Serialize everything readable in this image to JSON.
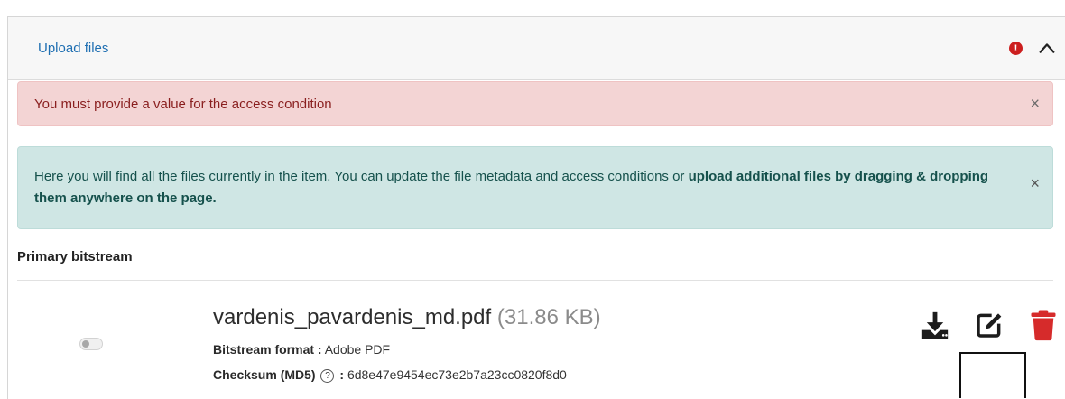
{
  "panel": {
    "title": "Upload files",
    "error_badge": "!"
  },
  "alerts": {
    "danger_text": "You must provide a value for the access condition",
    "info_text_1": "Here you will find all the files currently in the item. You can update the file metadata and access conditions or ",
    "info_text_bold": "upload additional files by dragging & dropping them anywhere on the page.",
    "close_symbol": "×"
  },
  "section": {
    "label": "Primary bitstream"
  },
  "file": {
    "name": "vardenis_pavardenis_md.pdf",
    "size": "(31.86 KB)",
    "format_label": "Bitstream format :",
    "format_value": "Adobe PDF",
    "checksum_label": "Checksum (MD5)",
    "checksum_sep": ":",
    "checksum_value": "6d8e47e9454ec73e2b7a23cc0820f8d0",
    "help_symbol": "?"
  },
  "icons": {
    "download": "download-icon",
    "edit": "edit-icon",
    "delete": "trash-icon",
    "chevron": "chevron-up-icon",
    "error": "exclamation-circle-icon",
    "help": "question-circle-icon"
  },
  "colors": {
    "link": "#1f6fb2",
    "danger_bg": "#f3d4d4",
    "info_bg": "#cfe6e4",
    "error_badge": "#cc1f1f",
    "delete": "#d62b2b"
  }
}
